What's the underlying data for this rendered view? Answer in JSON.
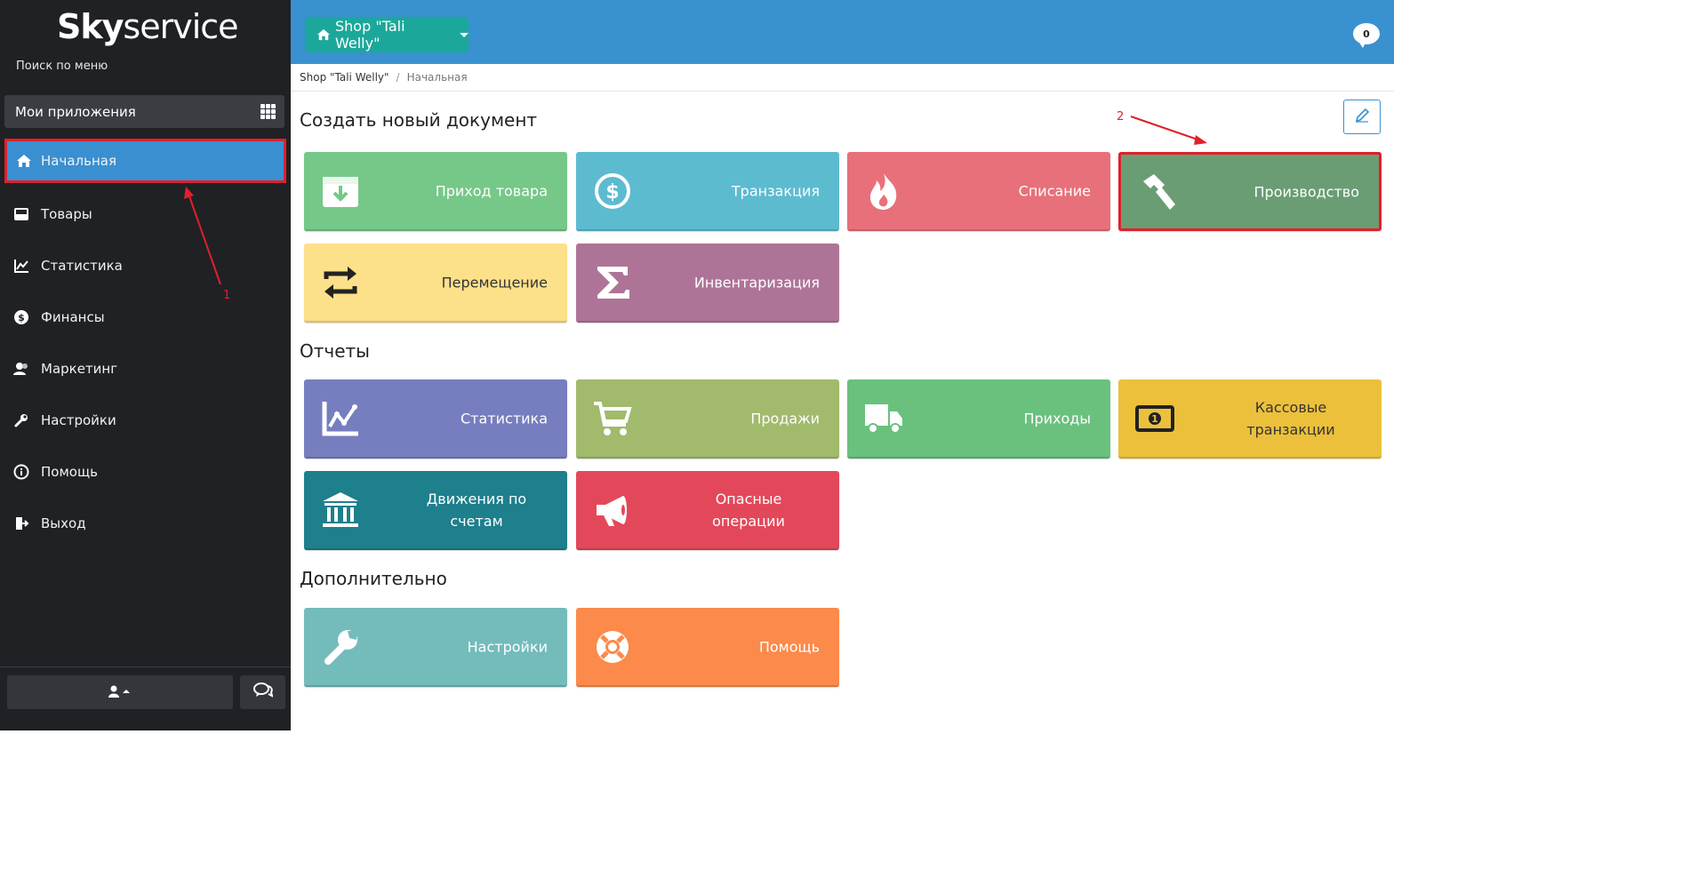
{
  "sidebar": {
    "logo_bold": "Sky",
    "logo_light": "service",
    "menu_search": "Поиск по меню",
    "apps_label": "Мои приложения",
    "items": [
      {
        "label": "Начальная",
        "icon": "home-icon",
        "active": true
      },
      {
        "label": "Товары",
        "icon": "inbox-icon"
      },
      {
        "label": "Статистика",
        "icon": "chart-icon"
      },
      {
        "label": "Финансы",
        "icon": "dollar-circle-icon"
      },
      {
        "label": "Маркетинг",
        "icon": "users-icon"
      },
      {
        "label": "Настройки",
        "icon": "wrench-icon"
      },
      {
        "label": "Помощь",
        "icon": "info-icon"
      },
      {
        "label": "Выход",
        "icon": "logout-icon"
      }
    ]
  },
  "header": {
    "shop_label": "Shop \"Tali Welly\"",
    "notifications_count": "0"
  },
  "breadcrumb": {
    "shop": "Shop \"Tali Welly\"",
    "separator": "/",
    "current": "Начальная"
  },
  "sections": {
    "create": "Создать новый документ",
    "reports": "Отчеты",
    "extra": "Дополнительно"
  },
  "tiles": {
    "create": [
      {
        "label": "Приход товара",
        "icon": "archive-download-icon",
        "color": "#76c889"
      },
      {
        "label": "Транзакция",
        "icon": "dollar-circle-icon",
        "color": "#5dbbd0"
      },
      {
        "label": "Списание",
        "icon": "fire-icon",
        "color": "#e8707a"
      },
      {
        "label": "Производство",
        "icon": "hammer-icon",
        "color": "#6a9d74"
      },
      {
        "label": "Перемещение",
        "icon": "transfer-arrows-icon",
        "color": "#fde08a"
      },
      {
        "label": "Инвентаризация",
        "icon": "sigma-icon",
        "color": "#ae7497"
      }
    ],
    "reports": [
      {
        "label": "Статистика",
        "icon": "line-chart-icon",
        "color": "#767ebf"
      },
      {
        "label": "Продажи",
        "icon": "cart-icon",
        "color": "#a1ba6c"
      },
      {
        "label": "Приходы",
        "icon": "truck-icon",
        "color": "#69c17d"
      },
      {
        "label": "Кассовые транзакции",
        "icon": "cash-icon",
        "color": "#ecc03b"
      },
      {
        "label": "Движения по счетам",
        "icon": "bank-icon",
        "color": "#1e7f8d"
      },
      {
        "label": "Опасные операции",
        "icon": "megaphone-icon",
        "color": "#e3485a"
      }
    ],
    "extra": [
      {
        "label": "Настройки",
        "icon": "wrench-icon",
        "color": "#73bcbb"
      },
      {
        "label": "Помощь",
        "icon": "lifebuoy-icon",
        "color": "#fb8a4b"
      }
    ]
  },
  "annotations": {
    "one": "1",
    "two": "2",
    "color": "#e0202a"
  }
}
